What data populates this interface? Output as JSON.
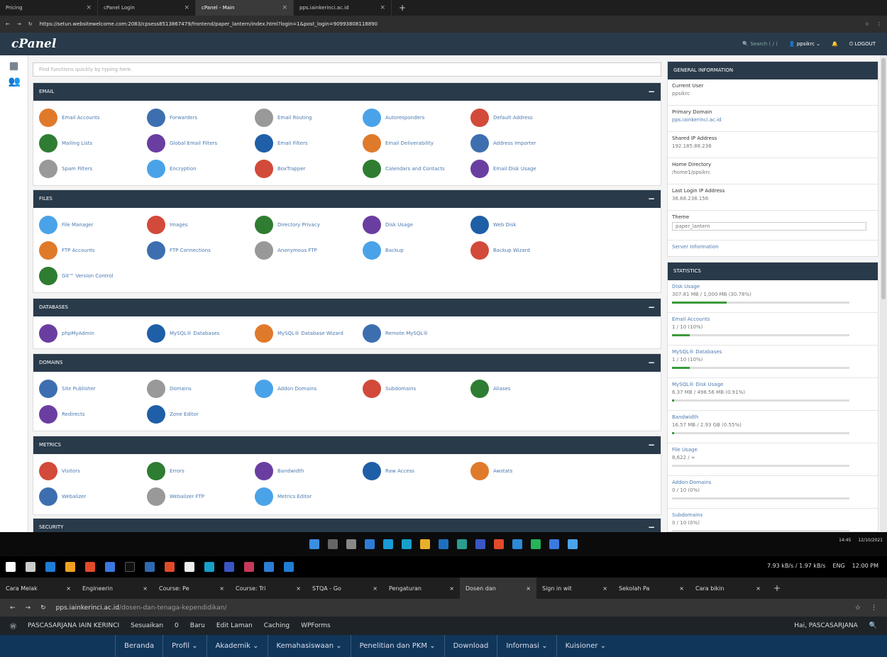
{
  "browser_top": {
    "tabs": [
      {
        "label": "Pricing"
      },
      {
        "label": "cPanel Login"
      },
      {
        "label": "cPanel - Main"
      },
      {
        "label": "pps.iainkerinci.ac.id"
      }
    ],
    "url": "https://setun.websitewelcome.com:2083/cpsess8513867479/frontend/paper_lantern/index.html?login=1&post_login=90993808118890"
  },
  "cpanel": {
    "logo": "cPanel",
    "search_placeholder": "Search ( / )",
    "user": "ppsikrc",
    "logout": "LOGOUT",
    "find_placeholder": "Find functions quickly by typing here."
  },
  "groups": [
    {
      "title": "EMAIL",
      "items": [
        "Email Accounts",
        "Forwarders",
        "Email Routing",
        "Autoresponders",
        "Default Address",
        "Mailing Lists",
        "Global Email Filters",
        "Email Filters",
        "Email Deliverability",
        "Address Importer",
        "Spam Filters",
        "Encryption",
        "BoxTrapper",
        "Calendars and Contacts",
        "Email Disk Usage"
      ]
    },
    {
      "title": "FILES",
      "items": [
        "File Manager",
        "Images",
        "Directory Privacy",
        "Disk Usage",
        "Web Disk",
        "FTP Accounts",
        "FTP Connections",
        "Anonymous FTP",
        "Backup",
        "Backup Wizard",
        "Git™ Version Control"
      ]
    },
    {
      "title": "DATABASES",
      "items": [
        "phpMyAdmin",
        "MySQL® Databases",
        "MySQL® Database Wizard",
        "Remote MySQL®"
      ]
    },
    {
      "title": "DOMAINS",
      "items": [
        "Site Publisher",
        "Domains",
        "Addon Domains",
        "Subdomains",
        "Aliases",
        "Redirects",
        "Zone Editor"
      ]
    },
    {
      "title": "METRICS",
      "items": [
        "Visitors",
        "Errors",
        "Bandwidth",
        "Raw Access",
        "Awstats",
        "Webalizer",
        "Webalizer FTP",
        "Metrics Editor"
      ]
    },
    {
      "title": "SECURITY",
      "items": []
    }
  ],
  "general": {
    "title": "GENERAL INFORMATION",
    "current_user_label": "Current User",
    "current_user": "ppsikrc",
    "primary_domain_label": "Primary Domain",
    "primary_domain": "pps.iainkerinci.ac.id",
    "shared_ip_label": "Shared IP Address",
    "shared_ip": "192.185.88.236",
    "home_dir_label": "Home Directory",
    "home_dir": "/home1/ppsikrc",
    "last_login_label": "Last Login IP Address",
    "last_login": "36.68.238.156",
    "theme_label": "Theme",
    "theme": "paper_lantern",
    "server_info": "Server Information"
  },
  "statistics": {
    "title": "STATISTICS",
    "rows": [
      {
        "label": "Disk Usage",
        "value": "307.81 MB / 1,000 MB (30.78%)",
        "fill": 0.3078
      },
      {
        "label": "Email Accounts",
        "value": "1 / 10 (10%)",
        "fill": 0.1
      },
      {
        "label": "MySQL® Databases",
        "value": "1 / 10 (10%)",
        "fill": 0.1
      },
      {
        "label": "MySQL® Disk Usage",
        "value": "6.37 MB / 498.56 MB (0.91%)",
        "fill": 0.0091
      },
      {
        "label": "Bandwidth",
        "value": "16.57 MB / 2.93 GB (0.55%)",
        "fill": 0.0055
      },
      {
        "label": "File Usage",
        "value": "8,622 / ∞",
        "fill": 0
      },
      {
        "label": "Addon Domains",
        "value": "0 / 10 (0%)",
        "fill": 0
      },
      {
        "label": "Subdomains",
        "value": "0 / 10 (0%)",
        "fill": 0
      }
    ]
  },
  "taskbar1": {
    "time": "14:45",
    "date": "12/10/2021"
  },
  "taskbar2": {
    "lang": "ENG",
    "time": "12:00 PM",
    "net_up": "7.93 kB/s",
    "net_down": "1.97 kB/s"
  },
  "browser_bottom": {
    "tabs": [
      "Cara Melak",
      "Engineerin",
      "Course: Pe",
      "Course: Tri",
      "STQA - Go",
      "Pengaturan",
      "Dosen dan",
      "Sign in wit",
      "Sekolah Pa",
      "Cara bikin"
    ],
    "domain": "pps.iainkerinci.ac.id",
    "path": "/dosen-dan-tenaga-kependidikan/"
  },
  "wp": {
    "site": "PASCASARJANA IAIN KERINCI",
    "customize": "Sesuaikan",
    "comments": "0",
    "new": "Baru",
    "edit": "Edit Laman",
    "caching": "Caching",
    "forms": "WPForms",
    "greeting": "Hai, PASCASARJANA"
  },
  "nav": [
    "Beranda",
    "Profil ⌄",
    "Akademik ⌄",
    "Kemahasiswaan ⌄",
    "Penelitian dan PKM ⌄",
    "Download",
    "Informasi ⌄",
    "Kuisioner ⌄"
  ]
}
